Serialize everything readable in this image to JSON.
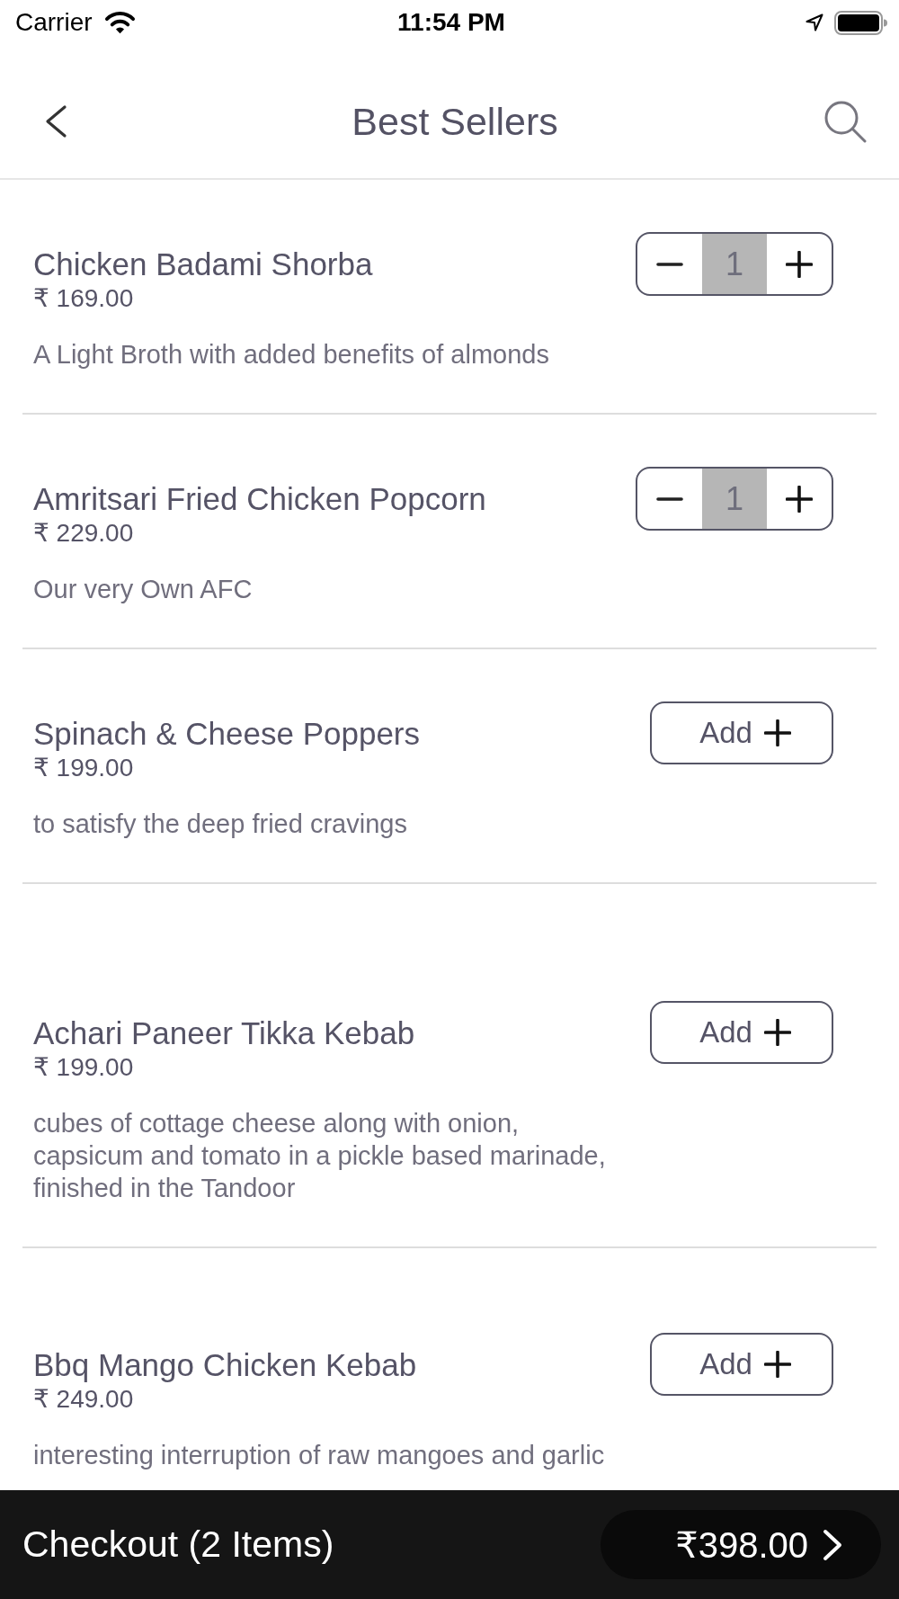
{
  "status_bar": {
    "carrier": "Carrier",
    "time": "11:54 PM"
  },
  "header": {
    "title": "Best Sellers"
  },
  "items": [
    {
      "kind": "stepper",
      "name": "Chicken Badami Shorba",
      "price": "₹ 169.00",
      "description": "A Light Broth with added benefits of almonds",
      "quantity": "1"
    },
    {
      "kind": "stepper",
      "name": "Amritsari Fried Chicken Popcorn",
      "price": "₹ 229.00",
      "description": "Our very Own AFC",
      "quantity": "1"
    },
    {
      "kind": "add",
      "name": "Spinach & Cheese Poppers",
      "price": "₹ 199.00",
      "description": "to satisfy the deep fried cravings",
      "button": "Add"
    },
    {
      "kind": "add",
      "name": "Achari Paneer Tikka Kebab",
      "price": "₹ 199.00",
      "description": "cubes of cottage cheese along with onion, capsicum and tomato in a pickle based marinade, finished in the Tandoor",
      "button": "Add"
    },
    {
      "kind": "add",
      "name": "Bbq Mango Chicken Kebab",
      "price": "₹ 249.00",
      "description": "interesting interruption of raw mangoes and garlic",
      "button": "Add"
    }
  ],
  "checkout": {
    "label": "Checkout (2 Items)",
    "total": "₹398.00"
  }
}
